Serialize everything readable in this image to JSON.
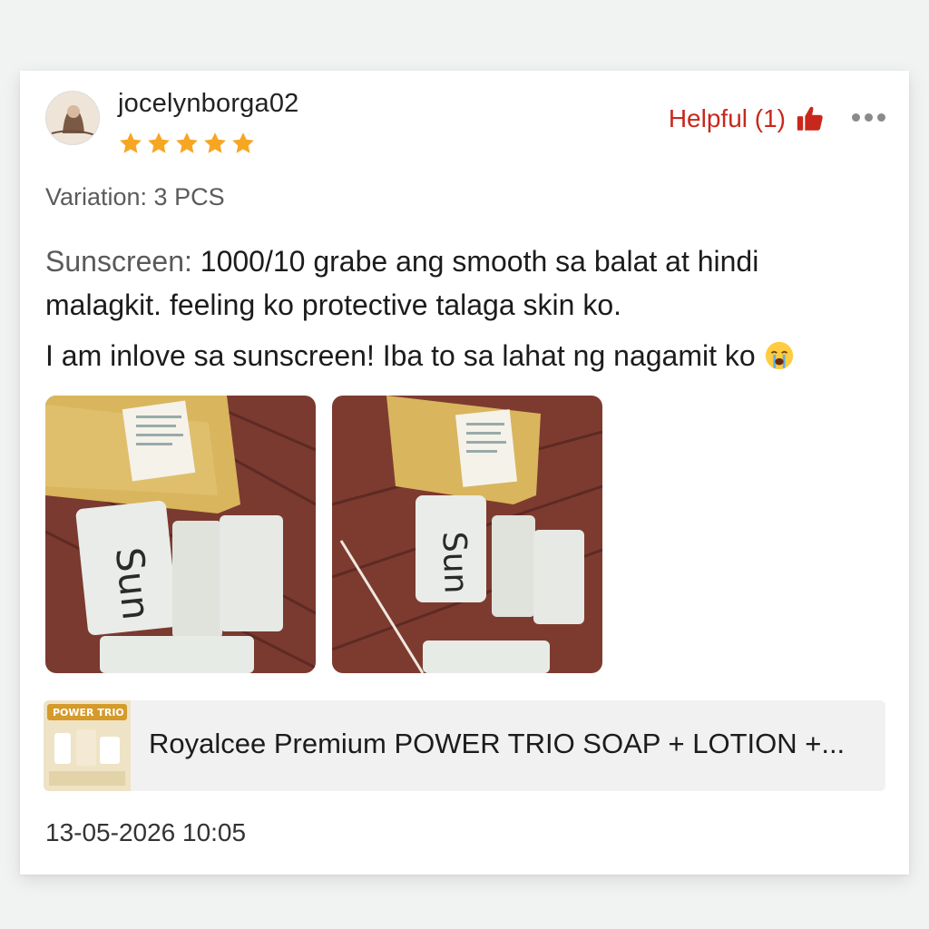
{
  "review": {
    "username": "jocelynborga02",
    "rating": 5,
    "rating_max": 5,
    "helpful_label": "Helpful (1)",
    "variation": "Variation: 3 PCS",
    "body_label": "Sunscreen:",
    "body_line1": " 1000/10 grabe ang smooth sa balat at hindi",
    "body_line2": "malagkit. feeling ko protective talaga skin ko.",
    "body_line3": "I am inlove sa sunscreen! Iba to sa lahat ng nagamit ko ",
    "photo_text_1": "Sun",
    "photo_text_2": "Sun",
    "product_name": "Royalcee Premium POWER TRIO SOAP + LOTION +...",
    "product_thumb_text": "POWER TRIO",
    "timestamp": "13-05-2026 10:05"
  },
  "colors": {
    "helpful_red": "#c8281c",
    "star_gold": "#f6a623",
    "background": "#f1f2f2"
  },
  "icons": {
    "avatar": "avatar-image",
    "helpful": "thumbs-up-icon",
    "more": "more-options-icon",
    "emoji": "crying-face-emoji"
  }
}
